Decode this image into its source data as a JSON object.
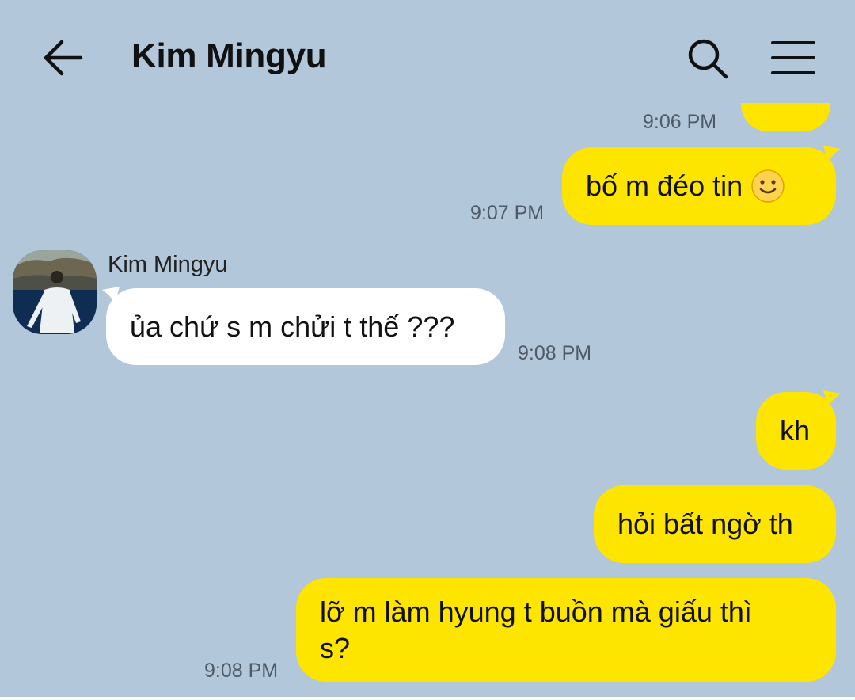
{
  "header": {
    "title": "Kim Mingyu"
  },
  "icons": {
    "back": "back-arrow-icon",
    "search": "search-icon",
    "menu": "menu-icon",
    "emoji": "slightly-smiling-face-icon"
  },
  "colors": {
    "background": "#b2c7da",
    "mine_bubble": "#fee500",
    "theirs_bubble": "#ffffff",
    "timestamp": "#4f5a66"
  },
  "messages": [
    {
      "from": "me",
      "text": "",
      "time": "9:06 PM"
    },
    {
      "from": "me",
      "text": "bố m đéo tin",
      "time": "9:07 PM"
    },
    {
      "from": "Kim Mingyu",
      "sender": "Kim Mingyu",
      "text": "ủa chứ s m chửi t thế ???",
      "time": "9:08 PM"
    },
    {
      "from": "me",
      "text": "kh"
    },
    {
      "from": "me",
      "text": "hỏi bất ngờ th"
    },
    {
      "from": "me",
      "text_line1": "lỡ m làm hyung t buồn mà giấu thì",
      "text_line2": "s?",
      "time": "9:08 PM"
    }
  ]
}
